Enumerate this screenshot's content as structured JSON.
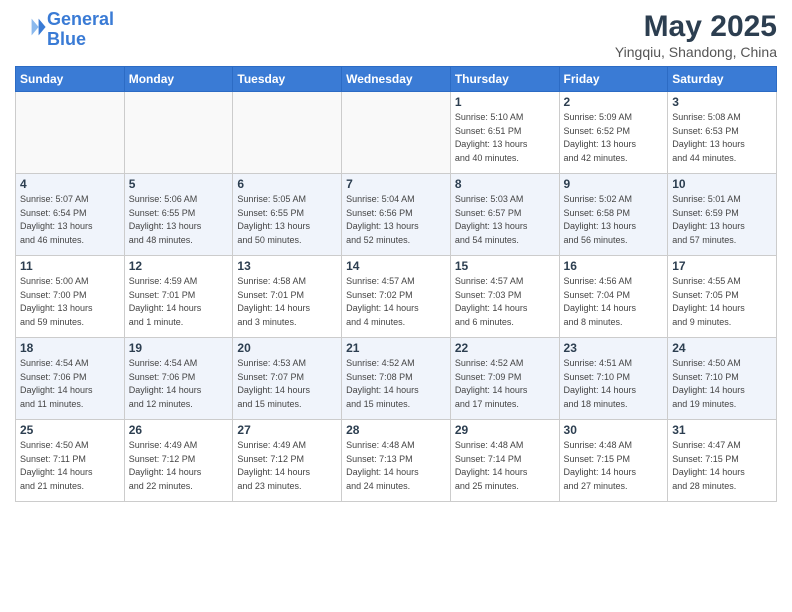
{
  "header": {
    "logo_line1": "General",
    "logo_line2": "Blue",
    "month_title": "May 2025",
    "location": "Yingqiu, Shandong, China"
  },
  "days_of_week": [
    "Sunday",
    "Monday",
    "Tuesday",
    "Wednesday",
    "Thursday",
    "Friday",
    "Saturday"
  ],
  "weeks": [
    [
      {
        "num": "",
        "detail": ""
      },
      {
        "num": "",
        "detail": ""
      },
      {
        "num": "",
        "detail": ""
      },
      {
        "num": "",
        "detail": ""
      },
      {
        "num": "1",
        "detail": "Sunrise: 5:10 AM\nSunset: 6:51 PM\nDaylight: 13 hours\nand 40 minutes."
      },
      {
        "num": "2",
        "detail": "Sunrise: 5:09 AM\nSunset: 6:52 PM\nDaylight: 13 hours\nand 42 minutes."
      },
      {
        "num": "3",
        "detail": "Sunrise: 5:08 AM\nSunset: 6:53 PM\nDaylight: 13 hours\nand 44 minutes."
      }
    ],
    [
      {
        "num": "4",
        "detail": "Sunrise: 5:07 AM\nSunset: 6:54 PM\nDaylight: 13 hours\nand 46 minutes."
      },
      {
        "num": "5",
        "detail": "Sunrise: 5:06 AM\nSunset: 6:55 PM\nDaylight: 13 hours\nand 48 minutes."
      },
      {
        "num": "6",
        "detail": "Sunrise: 5:05 AM\nSunset: 6:55 PM\nDaylight: 13 hours\nand 50 minutes."
      },
      {
        "num": "7",
        "detail": "Sunrise: 5:04 AM\nSunset: 6:56 PM\nDaylight: 13 hours\nand 52 minutes."
      },
      {
        "num": "8",
        "detail": "Sunrise: 5:03 AM\nSunset: 6:57 PM\nDaylight: 13 hours\nand 54 minutes."
      },
      {
        "num": "9",
        "detail": "Sunrise: 5:02 AM\nSunset: 6:58 PM\nDaylight: 13 hours\nand 56 minutes."
      },
      {
        "num": "10",
        "detail": "Sunrise: 5:01 AM\nSunset: 6:59 PM\nDaylight: 13 hours\nand 57 minutes."
      }
    ],
    [
      {
        "num": "11",
        "detail": "Sunrise: 5:00 AM\nSunset: 7:00 PM\nDaylight: 13 hours\nand 59 minutes."
      },
      {
        "num": "12",
        "detail": "Sunrise: 4:59 AM\nSunset: 7:01 PM\nDaylight: 14 hours\nand 1 minute."
      },
      {
        "num": "13",
        "detail": "Sunrise: 4:58 AM\nSunset: 7:01 PM\nDaylight: 14 hours\nand 3 minutes."
      },
      {
        "num": "14",
        "detail": "Sunrise: 4:57 AM\nSunset: 7:02 PM\nDaylight: 14 hours\nand 4 minutes."
      },
      {
        "num": "15",
        "detail": "Sunrise: 4:57 AM\nSunset: 7:03 PM\nDaylight: 14 hours\nand 6 minutes."
      },
      {
        "num": "16",
        "detail": "Sunrise: 4:56 AM\nSunset: 7:04 PM\nDaylight: 14 hours\nand 8 minutes."
      },
      {
        "num": "17",
        "detail": "Sunrise: 4:55 AM\nSunset: 7:05 PM\nDaylight: 14 hours\nand 9 minutes."
      }
    ],
    [
      {
        "num": "18",
        "detail": "Sunrise: 4:54 AM\nSunset: 7:06 PM\nDaylight: 14 hours\nand 11 minutes."
      },
      {
        "num": "19",
        "detail": "Sunrise: 4:54 AM\nSunset: 7:06 PM\nDaylight: 14 hours\nand 12 minutes."
      },
      {
        "num": "20",
        "detail": "Sunrise: 4:53 AM\nSunset: 7:07 PM\nDaylight: 14 hours\nand 15 minutes."
      },
      {
        "num": "21",
        "detail": "Sunrise: 4:52 AM\nSunset: 7:08 PM\nDaylight: 14 hours\nand 15 minutes."
      },
      {
        "num": "22",
        "detail": "Sunrise: 4:52 AM\nSunset: 7:09 PM\nDaylight: 14 hours\nand 17 minutes."
      },
      {
        "num": "23",
        "detail": "Sunrise: 4:51 AM\nSunset: 7:10 PM\nDaylight: 14 hours\nand 18 minutes."
      },
      {
        "num": "24",
        "detail": "Sunrise: 4:50 AM\nSunset: 7:10 PM\nDaylight: 14 hours\nand 19 minutes."
      }
    ],
    [
      {
        "num": "25",
        "detail": "Sunrise: 4:50 AM\nSunset: 7:11 PM\nDaylight: 14 hours\nand 21 minutes."
      },
      {
        "num": "26",
        "detail": "Sunrise: 4:49 AM\nSunset: 7:12 PM\nDaylight: 14 hours\nand 22 minutes."
      },
      {
        "num": "27",
        "detail": "Sunrise: 4:49 AM\nSunset: 7:12 PM\nDaylight: 14 hours\nand 23 minutes."
      },
      {
        "num": "28",
        "detail": "Sunrise: 4:48 AM\nSunset: 7:13 PM\nDaylight: 14 hours\nand 24 minutes."
      },
      {
        "num": "29",
        "detail": "Sunrise: 4:48 AM\nSunset: 7:14 PM\nDaylight: 14 hours\nand 25 minutes."
      },
      {
        "num": "30",
        "detail": "Sunrise: 4:48 AM\nSunset: 7:15 PM\nDaylight: 14 hours\nand 27 minutes."
      },
      {
        "num": "31",
        "detail": "Sunrise: 4:47 AM\nSunset: 7:15 PM\nDaylight: 14 hours\nand 28 minutes."
      }
    ]
  ]
}
